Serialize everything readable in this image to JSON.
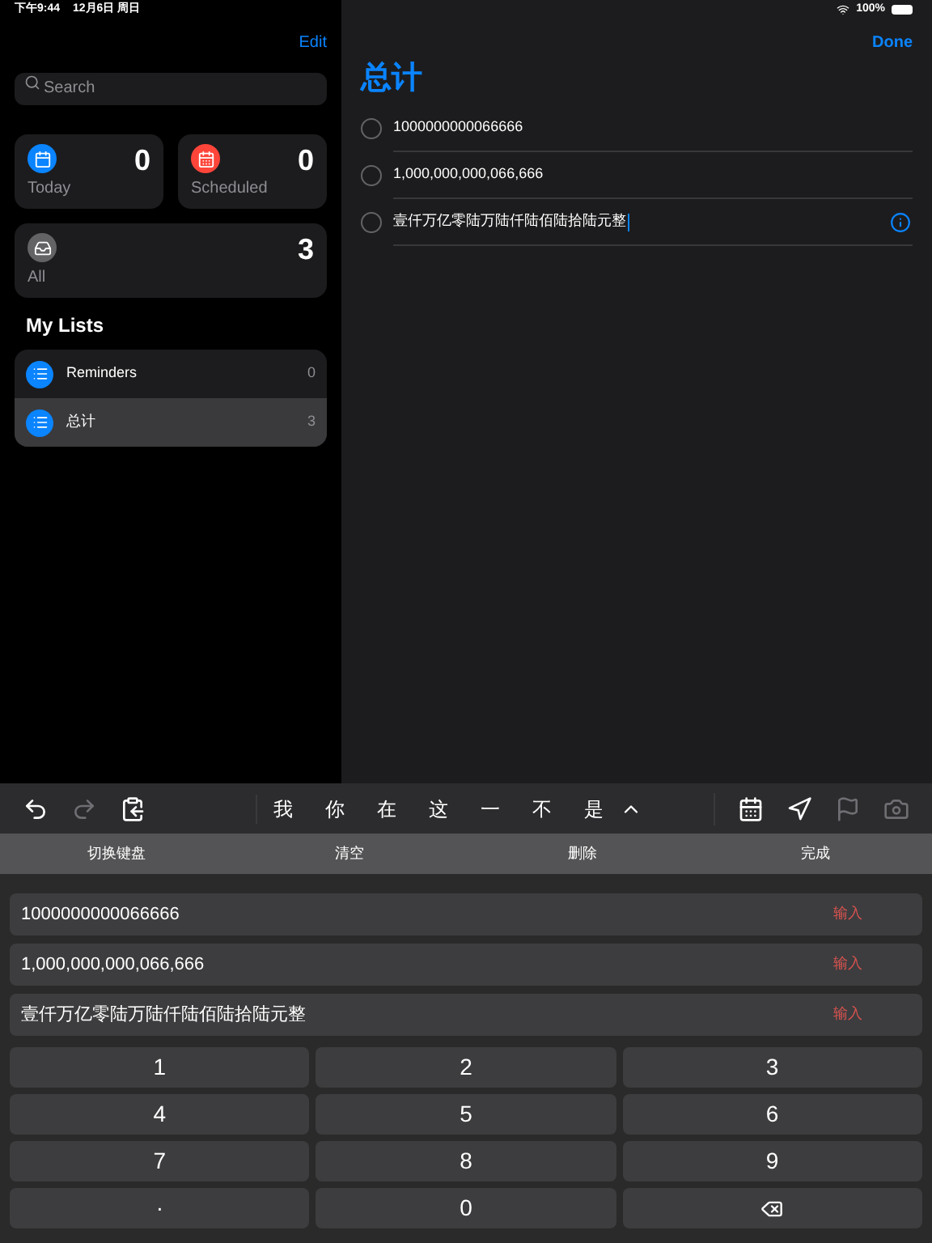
{
  "status_bar": {
    "time": "下午9:44",
    "date": "12月6日 周日",
    "battery": "100%"
  },
  "sidebar": {
    "edit": "Edit",
    "search": {
      "placeholder": "Search"
    },
    "smart_lists": [
      {
        "kind": "today",
        "label": "Today",
        "count": "0"
      },
      {
        "kind": "scheduled",
        "label": "Scheduled",
        "count": "0"
      },
      {
        "kind": "all",
        "label": "All",
        "count": "3"
      }
    ],
    "my_lists_title": "My Lists",
    "lists": [
      {
        "name": "Reminders",
        "count": "0",
        "selected": false
      },
      {
        "name": "总计",
        "count": "3",
        "selected": true
      }
    ]
  },
  "detail": {
    "done": "Done",
    "title": "总计",
    "reminders": [
      {
        "text": "1000000000066666",
        "editing": false
      },
      {
        "text": "1,000,000,000,066,666",
        "editing": false
      },
      {
        "text": "壹仟万亿零陆万陆仟陆佰陆拾陆元整",
        "editing": true
      }
    ]
  },
  "keyboard_toolbar": {
    "left_tools": [
      {
        "kind": "undo",
        "disabled": false
      },
      {
        "kind": "redo",
        "disabled": true
      },
      {
        "kind": "paste",
        "disabled": false
      }
    ],
    "candidates": [
      "我",
      "你",
      "在",
      "这",
      "一",
      "不",
      "是"
    ],
    "right_tools": [
      {
        "kind": "calendar",
        "disabled": false
      },
      {
        "kind": "location",
        "disabled": false
      },
      {
        "kind": "flag",
        "disabled": true
      },
      {
        "kind": "camera",
        "disabled": true
      }
    ]
  },
  "function_row": [
    "切换键盘",
    "清空",
    "删除",
    "完成"
  ],
  "results": [
    {
      "value": "1000000000066666",
      "action": "输入"
    },
    {
      "value": "1,000,000,000,066,666",
      "action": "输入"
    },
    {
      "value": "壹仟万亿零陆万陆仟陆佰陆拾陆元整",
      "action": "输入"
    }
  ],
  "keypad": [
    {
      "kind": "key",
      "label": "1"
    },
    {
      "kind": "key",
      "label": "2"
    },
    {
      "kind": "key",
      "label": "3"
    },
    {
      "kind": "key",
      "label": "4"
    },
    {
      "kind": "key",
      "label": "5"
    },
    {
      "kind": "key",
      "label": "6"
    },
    {
      "kind": "key",
      "label": "7"
    },
    {
      "kind": "key",
      "label": "8"
    },
    {
      "kind": "key",
      "label": "9"
    },
    {
      "kind": "key",
      "label": "·"
    },
    {
      "kind": "key",
      "label": "0"
    },
    {
      "kind": "delete"
    }
  ]
}
